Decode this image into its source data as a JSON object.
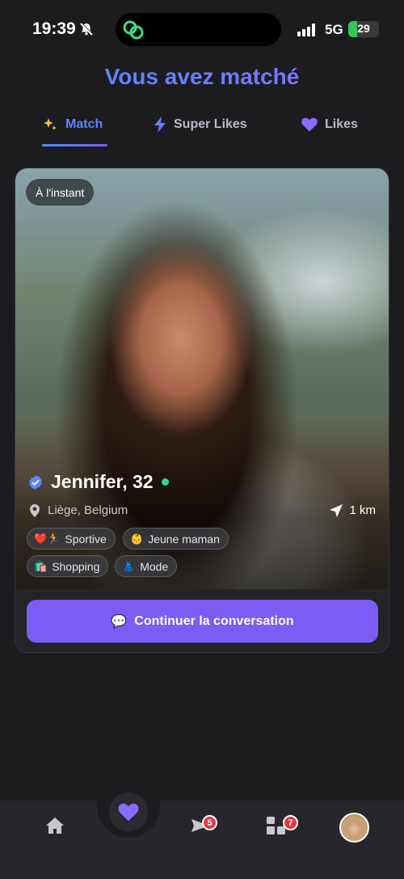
{
  "status_bar": {
    "time": "19:39",
    "network": "5G",
    "battery": "29",
    "battery_level": 0.29
  },
  "title": "Vous avez matché",
  "tabs": [
    {
      "icon": "sparkles-icon",
      "label": "Match",
      "active": true
    },
    {
      "icon": "bolt-icon",
      "label": "Super Likes",
      "active": false
    },
    {
      "icon": "heart-icon",
      "label": "Likes",
      "active": false
    }
  ],
  "card": {
    "time_badge": "À l'instant",
    "name": "Jennifer, 32",
    "verified": true,
    "online": true,
    "location": "Liège, Belgium",
    "distance": "1 km",
    "tags": [
      {
        "emoji": "❤️🏃",
        "label": "Sportive"
      },
      {
        "emoji": "👶",
        "label": "Jeune maman"
      },
      {
        "emoji": "🛍️",
        "label": "Shopping"
      },
      {
        "emoji": "👗",
        "label": "Mode"
      }
    ],
    "cta": {
      "icon": "💬",
      "label": "Continuer la conversation"
    }
  },
  "bottom_nav": {
    "items": [
      "home-icon",
      "heart-icon",
      "messages-icon",
      "grid-icon",
      "avatar"
    ],
    "badges": {
      "messages": "5",
      "grid": "7"
    }
  },
  "colors": {
    "accent": "#7b5cf5",
    "tab_active": "#5b86ff",
    "online": "#34d399",
    "badge": "#e5373f"
  }
}
